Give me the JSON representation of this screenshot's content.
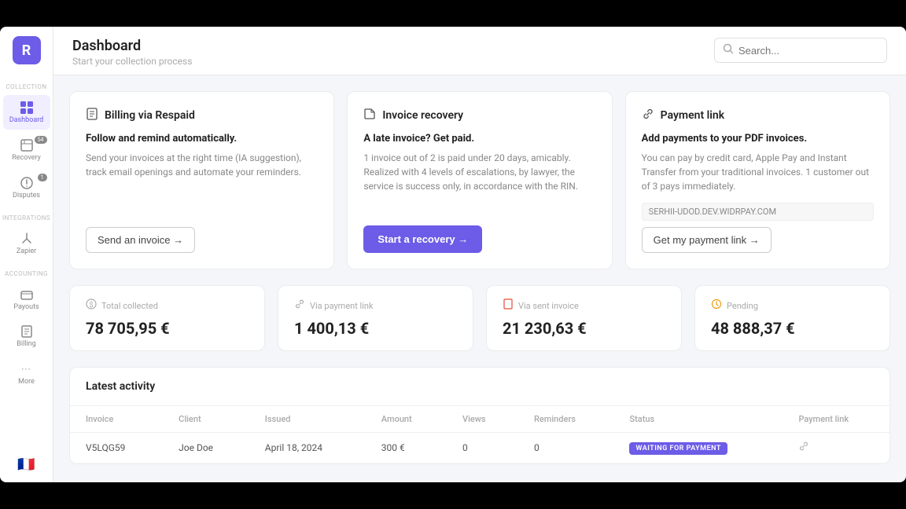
{
  "app": {
    "logo": "R",
    "logo_bg": "#6c5ce7"
  },
  "sidebar": {
    "items": [
      {
        "id": "dashboard",
        "label": "Dashboard",
        "icon": "⊞",
        "active": true
      },
      {
        "id": "recovery",
        "label": "Recovery",
        "icon": "📁",
        "badge": "54",
        "active": false
      },
      {
        "id": "disputes",
        "label": "Disputes",
        "icon": "⚡",
        "badge": "1",
        "active": false
      },
      {
        "id": "zapier",
        "label": "Zapier",
        "icon": "🔗",
        "active": false
      },
      {
        "id": "payouts",
        "label": "Payouts",
        "icon": "📤",
        "active": false
      },
      {
        "id": "billing",
        "label": "Billing",
        "icon": "🗂",
        "active": false
      },
      {
        "id": "more",
        "label": "More",
        "icon": "···",
        "active": false
      }
    ],
    "sections": {
      "collection": "COLLECTION",
      "integrations": "INTEGRATIONS",
      "accounting": "ACCOUNTING"
    },
    "flag": "🇫🇷"
  },
  "header": {
    "title": "Dashboard",
    "subtitle": "Start your collection process",
    "search_placeholder": "Search..."
  },
  "cards": [
    {
      "id": "billing",
      "icon": "📄",
      "title": "Billing via Respaid",
      "bold_text": "Follow and remind automatically.",
      "description": "Send your invoices at the right time (IA suggestion), track email openings and automate your reminders.",
      "button_label": "Send an invoice →"
    },
    {
      "id": "invoice-recovery",
      "icon": "📂",
      "title": "Invoice recovery",
      "bold_text": "A late invoice? Get paid.",
      "description": "1 invoice out of 2 is paid under 20 days, amicably. Realized with 4 levels of escalations, by lawyer, the service is success only, in accordance with the RIN.",
      "button_label": "Start a recovery →",
      "button_primary": true
    },
    {
      "id": "payment-link",
      "icon": "🔗",
      "title": "Payment link",
      "bold_text": "Add payments to your PDF invoices.",
      "description": "You can pay by credit card, Apple Pay and Instant Transfer from your traditional invoices. 1 customer out of 3 pays immediately.",
      "link_text": "SERHII-UDOD.DEV.WIDRPAY.COM",
      "button_label": "Get my payment link →"
    }
  ],
  "stats": [
    {
      "id": "total-collected",
      "label": "Total collected",
      "icon": "💲",
      "value": "78 705,95 €"
    },
    {
      "id": "via-payment-link",
      "label": "Via payment link",
      "icon": "🔗",
      "value": "1 400,13 €"
    },
    {
      "id": "via-sent-invoice",
      "label": "Via sent invoice",
      "icon": "📄",
      "value": "21 230,63 €",
      "icon_color": "#e74c3c"
    },
    {
      "id": "pending",
      "label": "Pending",
      "icon": "⏳",
      "value": "48 888,37 €",
      "icon_color": "#f39c12"
    }
  ],
  "activity": {
    "title": "Latest activity",
    "columns": [
      "Invoice",
      "Client",
      "Issued",
      "Amount",
      "Views",
      "Reminders",
      "Status",
      "Payment link"
    ],
    "rows": [
      {
        "invoice": "V5LQG59",
        "client": "Joe Doe",
        "issued": "April 18, 2024",
        "amount": "300 €",
        "views": "0",
        "reminders": "0",
        "status": "WAITING FOR PAYMENT",
        "payment_link": "🔗"
      }
    ]
  }
}
